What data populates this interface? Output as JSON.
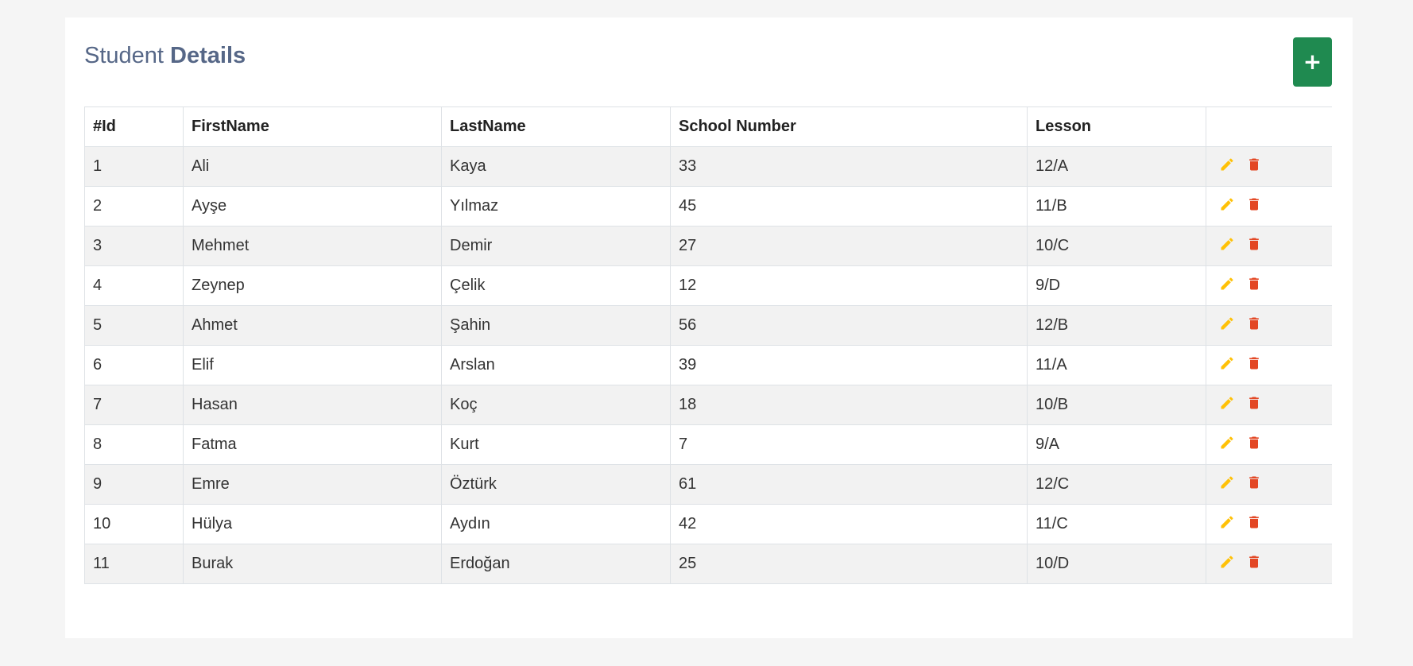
{
  "header": {
    "title_prefix": "Student",
    "title_bold": "Details",
    "add_label": "+"
  },
  "table": {
    "columns": [
      "#Id",
      "FirstName",
      "LastName",
      "School Number",
      "Lesson",
      ""
    ],
    "rows": [
      {
        "id": "1",
        "first": "Ali",
        "last": "Kaya",
        "number": "33",
        "lesson": "12/A"
      },
      {
        "id": "2",
        "first": "Ayşe",
        "last": "Yılmaz",
        "number": "45",
        "lesson": "11/B"
      },
      {
        "id": "3",
        "first": "Mehmet",
        "last": "Demir",
        "number": "27",
        "lesson": "10/C"
      },
      {
        "id": "4",
        "first": "Zeynep",
        "last": "Çelik",
        "number": "12",
        "lesson": "9/D"
      },
      {
        "id": "5",
        "first": "Ahmet",
        "last": "Şahin",
        "number": "56",
        "lesson": "12/B"
      },
      {
        "id": "6",
        "first": "Elif",
        "last": "Arslan",
        "number": "39",
        "lesson": "11/A"
      },
      {
        "id": "7",
        "first": "Hasan",
        "last": "Koç",
        "number": "18",
        "lesson": "10/B"
      },
      {
        "id": "8",
        "first": "Fatma",
        "last": "Kurt",
        "number": "7",
        "lesson": "9/A"
      },
      {
        "id": "9",
        "first": "Emre",
        "last": "Öztürk",
        "number": "61",
        "lesson": "12/C"
      },
      {
        "id": "10",
        "first": "Hülya",
        "last": "Aydın",
        "number": "42",
        "lesson": "11/C"
      },
      {
        "id": "11",
        "first": "Burak",
        "last": "Erdoğan",
        "number": "25",
        "lesson": "10/D"
      }
    ],
    "row_actions": [
      "pencil-icon",
      "trash-icon"
    ]
  },
  "colors": {
    "title": "#566787",
    "add_button": "#1f8a50",
    "edit_icon": "#ffc107",
    "delete_icon": "#e34724"
  }
}
